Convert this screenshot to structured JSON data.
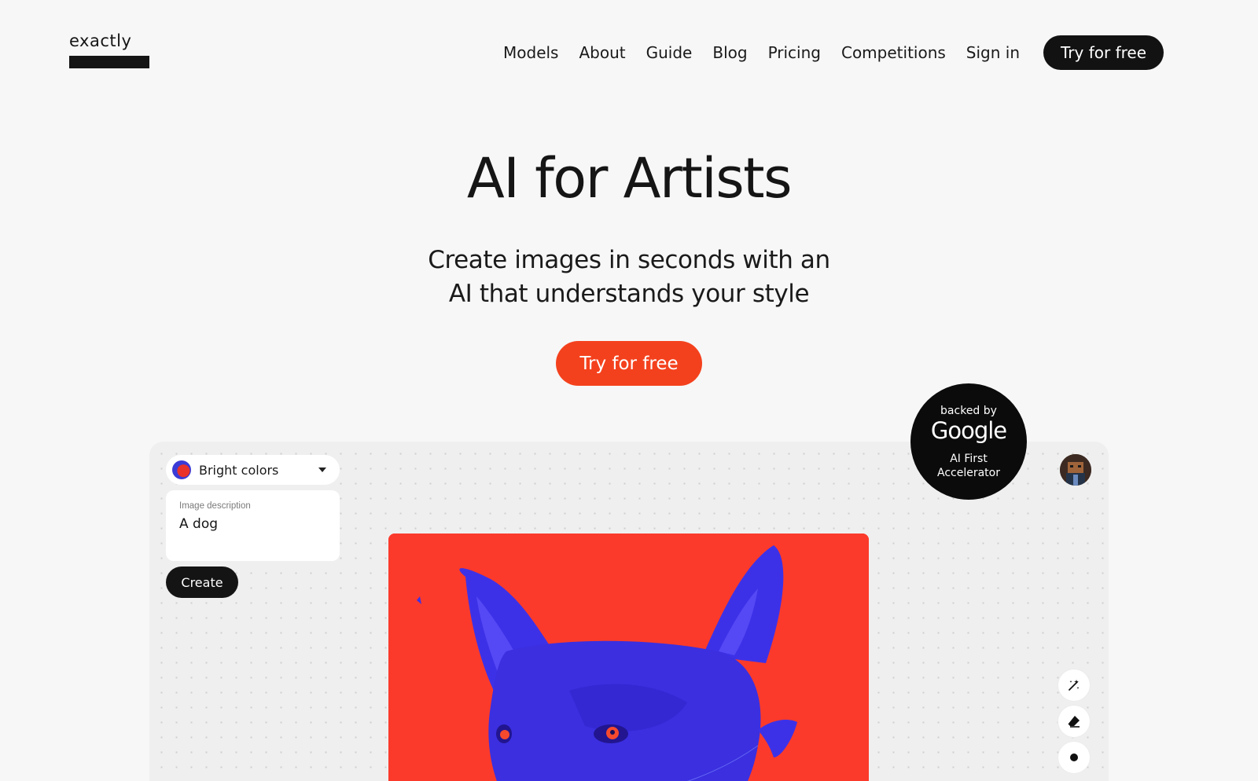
{
  "header": {
    "logo_text": "exactly",
    "nav": [
      {
        "label": "Models"
      },
      {
        "label": "About"
      },
      {
        "label": "Guide"
      },
      {
        "label": "Blog"
      },
      {
        "label": "Pricing"
      },
      {
        "label": "Competitions"
      },
      {
        "label": "Sign in"
      }
    ],
    "cta_label": "Try for free"
  },
  "hero": {
    "title": "AI for Artists",
    "subtitle_line1": "Create images in seconds with an",
    "subtitle_line2": "AI that understands your style",
    "cta_label": "Try for free"
  },
  "badge": {
    "top": "backed by",
    "brand": "Google",
    "line1": "AI First",
    "line2": "Accelerator"
  },
  "editor": {
    "style_select": {
      "selected": "Bright colors"
    },
    "description": {
      "label": "Image description",
      "value": "A dog"
    },
    "create_label": "Create",
    "tools": [
      "wand-icon",
      "eraser-icon",
      "brush-dot-icon"
    ]
  },
  "colors": {
    "accent": "#f4411d",
    "dark": "#121212",
    "background": "#f7f7f7",
    "artwork_bg": "#fb3a2b",
    "artwork_dog": "#3d31e8"
  }
}
